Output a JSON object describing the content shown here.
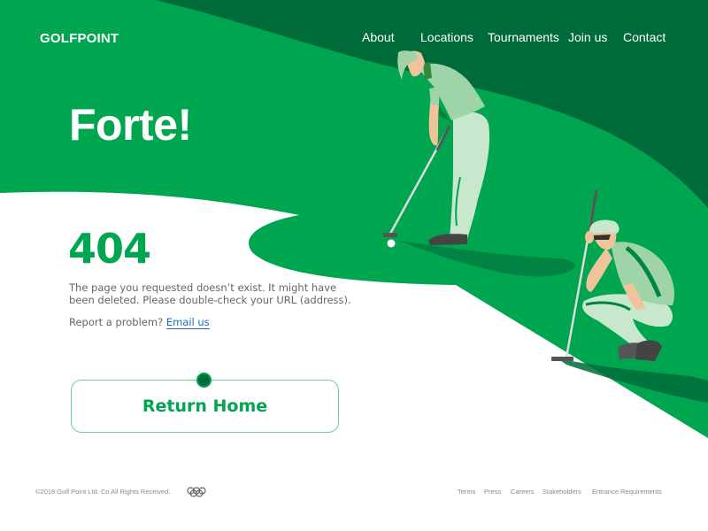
{
  "brand": {
    "logo": "GOLFPOINT"
  },
  "nav": {
    "items": [
      {
        "label": "About"
      },
      {
        "label": "Locations"
      },
      {
        "label": "Tournaments"
      },
      {
        "label": "Join us"
      },
      {
        "label": "Contact"
      }
    ]
  },
  "hero": {
    "title": "Forte!"
  },
  "error": {
    "code": "404",
    "message": "The page you requested doesn’t exist. It might have been deleted. Please double-check your URL (address).",
    "report_prefix": "Report a problem?",
    "report_link": "Email us",
    "button_label": "Return Home"
  },
  "illustration": {
    "icons": [
      "golfer-putting-icon",
      "golfer-crouching-icon"
    ]
  },
  "footer": {
    "copyright": "©2018 Golf Point Ltd. Co All Rights Received.",
    "rings_icon": "rings-icon",
    "links": [
      {
        "label": "Terms"
      },
      {
        "label": "Press"
      },
      {
        "label": "Careers"
      },
      {
        "label": "Stakeholders"
      },
      {
        "label": "Entrance Requirements"
      }
    ]
  },
  "colors": {
    "primary": "#00a550",
    "dark": "#006b3a",
    "light": "#9fd4a8",
    "pale": "#c8e8cd",
    "link": "#1a6fc4",
    "text": "#666666",
    "footer_text": "#888888"
  }
}
